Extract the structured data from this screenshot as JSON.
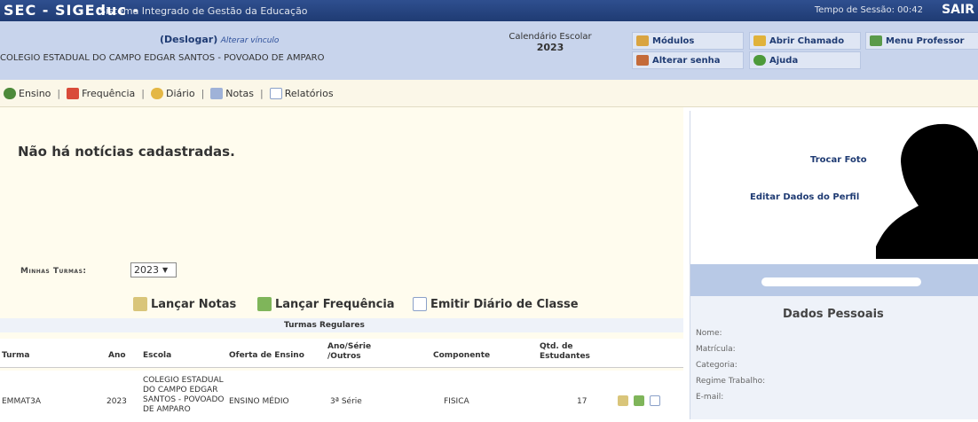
{
  "topbar": {
    "brand": "SEC - SIGEduc -",
    "subtitle": "Sistema Integrado de Gestão da Educação",
    "session": "Tempo de Sessão: 00:42",
    "user_short": "SAIR"
  },
  "infobar": {
    "logout": "(Deslogar)",
    "change_link": "Alterar vínculo",
    "school": "COLEGIO ESTADUAL DO CAMPO EDGAR SANTOS - POVOADO DE AMPARO",
    "calendar_label": "Calendário Escolar",
    "calendar_year": "2023"
  },
  "menu": {
    "modulos": "Módulos",
    "abrir_chamado": "Abrir Chamado",
    "menu_professor": "Menu Professor",
    "alterar_senha": "Alterar senha",
    "ajuda": "Ajuda"
  },
  "nav": {
    "ensino": "Ensino",
    "frequencia": "Frequência",
    "diario": "Diário",
    "notas": "Notas",
    "relatorios": "Relatórios",
    "separator": "|"
  },
  "news": {
    "message": "Não há notícias cadastradas."
  },
  "profile": {
    "trocar_foto": "Trocar Foto",
    "editar": "Editar Dados do Perfil",
    "dados_title": "Dados Pessoais",
    "fields": [
      "Nome:",
      "Matrícula:",
      "Categoria:",
      "Regime Trabalho:",
      "E-mail:"
    ]
  },
  "turmas": {
    "label": "Minhas Turmas:",
    "year": "2023",
    "actions": [
      "Lançar Notas",
      "Lançar Frequência",
      "Emitir Diário de Classe"
    ],
    "section_title": "Turmas Regulares",
    "headers": {
      "turma": "Turma",
      "ano": "Ano",
      "escola": "Escola",
      "oferta": "Oferta de Ensino",
      "serie_1": "Ano/Série",
      "serie_2": "/Outros",
      "componente": "Componente",
      "qtd_1": "Qtd. de",
      "qtd_2": "Estudantes"
    },
    "row": {
      "turma": "EMMAT3A",
      "ano": "2023",
      "escola_1": "COLEGIO ESTADUAL",
      "escola_2": "DO CAMPO EDGAR",
      "escola_3": "SANTOS - POVOADO",
      "escola_4": "DE AMPARO",
      "oferta": "ENSINO MÉDIO",
      "serie": "3ª Série",
      "componente": "FISICA",
      "qtd": "17"
    }
  },
  "colors": {
    "topbar": "#1f3b73",
    "infobar": "#c8d4ec",
    "nav_bg": "#fbf7e8",
    "news_bg": "#fffcee",
    "link": "#1f3b73"
  }
}
